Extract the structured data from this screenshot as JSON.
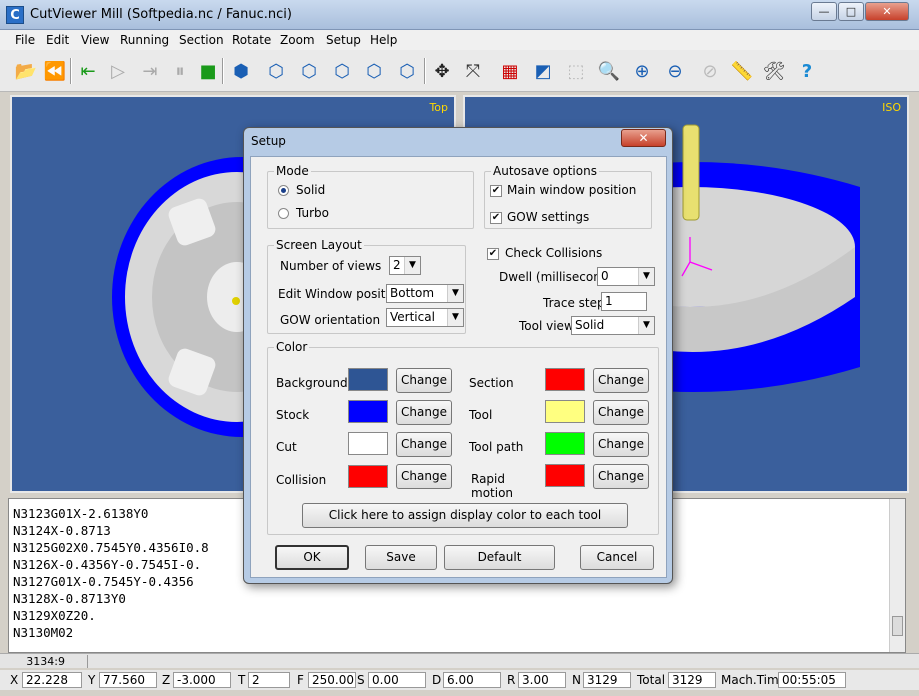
{
  "window": {
    "title": "CutViewer Mill (Softpedia.nc / Fanuc.nci)",
    "icon_letter": "C",
    "controls": {
      "minimize": "—",
      "maximize": "□",
      "close": "✕"
    }
  },
  "menu": [
    "File",
    "Edit",
    "View",
    "Running",
    "Section",
    "Rotate",
    "Zoom",
    "Setup",
    "Help"
  ],
  "views": {
    "left_label": "Top",
    "right_label": "ISO"
  },
  "gcode_lines": [
    "N3123G01X-2.6138Y0",
    "N3124X-0.8713",
    "N3125G02X0.7545Y0.4356I0.8",
    "N3126X-0.4356Y-0.7545I-0.",
    "N3127G01X-0.7545Y-0.4356",
    "N3128X-0.8713Y0",
    "N3129X0Z20.",
    "N3130M02"
  ],
  "status": {
    "position": "3134:9"
  },
  "coords": {
    "x_label": "X",
    "x": "22.228",
    "y_label": "Y",
    "y": "77.560",
    "z_label": "Z",
    "z": "-3.000",
    "t_label": "T",
    "t": "2",
    "f_label": "F",
    "f": "250.00",
    "s_label": "S",
    "s": "0.00",
    "d_label": "D",
    "d": "6.00",
    "r_label": "R",
    "r": "3.00",
    "n_label": "N",
    "n": "3129",
    "total_label": "Total",
    "total": "3129",
    "mach_label": "Mach.Tim",
    "mach": "00:55:05"
  },
  "dialog": {
    "title": "Setup",
    "close": "✕",
    "mode": {
      "title": "Mode",
      "solid": "Solid",
      "turbo": "Turbo"
    },
    "autosave": {
      "title": "Autosave options",
      "main_window": "Main window position",
      "gow": "GOW settings"
    },
    "screen_layout": {
      "title": "Screen Layout",
      "num_views_label": "Number of views",
      "num_views": "2",
      "edit_pos_label": "Edit Window position",
      "edit_pos": "Bottom",
      "gow_label": "GOW orientation",
      "gow": "Vertical"
    },
    "collisions": {
      "check_label": "Check Collisions"
    },
    "dwell": {
      "label": "Dwell (milliseconds)",
      "value": "0"
    },
    "trace": {
      "label": "Trace step",
      "value": "1"
    },
    "tool_view": {
      "label": "Tool view",
      "value": "Solid"
    },
    "color": {
      "title": "Color",
      "background_label": "Background",
      "background_color": "#2e5594",
      "stock_label": "Stock",
      "stock_color": "#0000ff",
      "cut_label": "Cut",
      "cut_color": "#ffffff",
      "collision_label": "Collision",
      "collision_color": "#ff0000",
      "section_label": "Section",
      "section_color": "#ff0000",
      "tool_label": "Tool",
      "tool_color": "#ffff80",
      "toolpath_label": "Tool path",
      "toolpath_color": "#00ff00",
      "rapid_label": "Rapid motion",
      "rapid_color": "#ff0000",
      "change_label": "Change",
      "assign_label": "Click here to assign  display color to each tool"
    },
    "buttons": {
      "ok": "OK",
      "save": "Save",
      "default": "Default",
      "cancel": "Cancel"
    }
  }
}
